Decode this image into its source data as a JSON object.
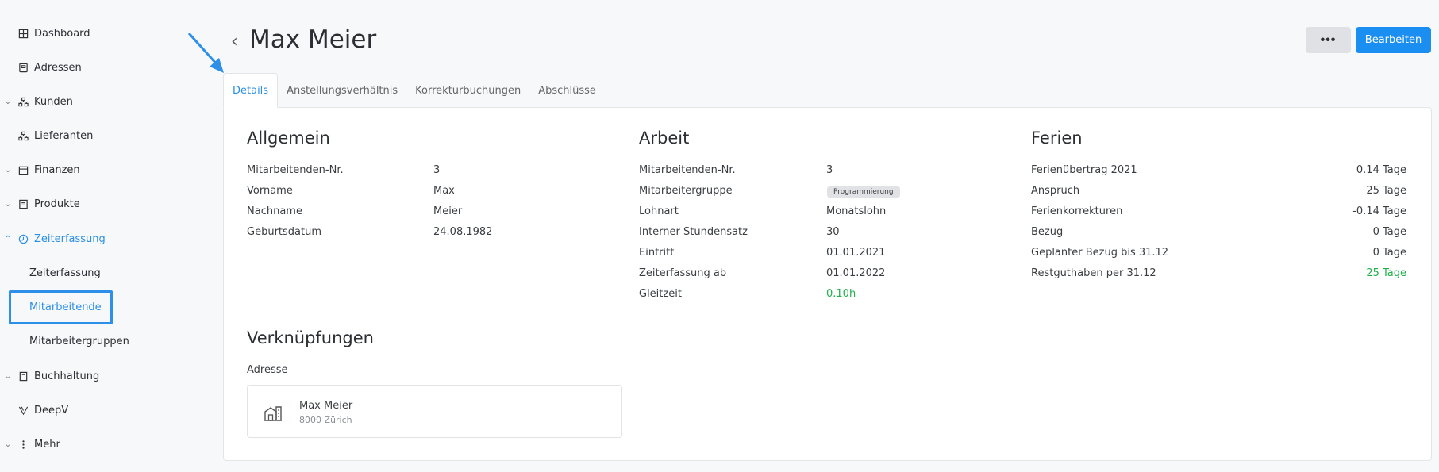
{
  "sidebar": {
    "items": [
      {
        "label": "Dashboard",
        "icon": "grid-icon",
        "has_chevron": false
      },
      {
        "label": "Adressen",
        "icon": "address-book-icon",
        "has_chevron": false
      },
      {
        "label": "Kunden",
        "icon": "org-chart-icon",
        "has_chevron": true
      },
      {
        "label": "Lieferanten",
        "icon": "org-chart-icon",
        "has_chevron": false
      },
      {
        "label": "Finanzen",
        "icon": "calendar-icon",
        "has_chevron": true
      },
      {
        "label": "Produkte",
        "icon": "box-icon",
        "has_chevron": true
      },
      {
        "label": "Zeiterfassung",
        "icon": "clock-icon",
        "has_chevron": true,
        "expanded": true
      },
      {
        "label": "Buchhaltung",
        "icon": "ledger-icon",
        "has_chevron": true
      },
      {
        "label": "DeepV",
        "icon": "deepv-icon",
        "has_chevron": false
      },
      {
        "label": "Mehr",
        "icon": "more-vertical-icon",
        "has_chevron": true
      }
    ],
    "sub_items": [
      "Zeiterfassung",
      "Mitarbeitende",
      "Mitarbeitergruppen"
    ],
    "active_sub": "Mitarbeitende"
  },
  "header": {
    "title": "Max Meier",
    "more_label": "•••",
    "edit_label": "Bearbeiten"
  },
  "tabs": [
    {
      "label": "Details",
      "active": true
    },
    {
      "label": "Anstellungsverhältnis",
      "active": false
    },
    {
      "label": "Korrekturbuchungen",
      "active": false
    },
    {
      "label": "Abschlüsse",
      "active": false
    }
  ],
  "allgemein": {
    "title": "Allgemein",
    "rows": [
      {
        "label": "Mitarbeitenden-Nr.",
        "value": "3"
      },
      {
        "label": "Vorname",
        "value": "Max"
      },
      {
        "label": "Nachname",
        "value": "Meier"
      },
      {
        "label": "Geburtsdatum",
        "value": "24.08.1982"
      }
    ]
  },
  "arbeit": {
    "title": "Arbeit",
    "rows": [
      {
        "label": "Mitarbeitenden-Nr.",
        "value": "3"
      },
      {
        "label": "Mitarbeitergruppe",
        "value": "Programmierung"
      },
      {
        "label": "Lohnart",
        "value": "Monatslohn"
      },
      {
        "label": "Interner Stundensatz",
        "value": "30"
      },
      {
        "label": "Eintritt",
        "value": "01.01.2021"
      },
      {
        "label": "Zeiterfassung ab",
        "value": "01.01.2022"
      },
      {
        "label": "Gleitzeit",
        "value": "0.10h"
      }
    ]
  },
  "ferien": {
    "title": "Ferien",
    "rows": [
      {
        "label": "Ferienübertrag 2021",
        "value": "0.14 Tage"
      },
      {
        "label": "Anspruch",
        "value": "25 Tage"
      },
      {
        "label": "Ferienkorrekturen",
        "value": "-0.14 Tage"
      },
      {
        "label": "Bezug",
        "value": "0 Tage"
      },
      {
        "label": "Geplanter Bezug bis 31.12",
        "value": "0 Tage"
      },
      {
        "label": "Restguthaben per 31.12",
        "value": "25 Tage"
      }
    ]
  },
  "verknuepfungen": {
    "title": "Verknüpfungen",
    "adresse_label": "Adresse",
    "card": {
      "name": "Max Meier",
      "address": "8000 Zürich",
      "icon": "building-icon"
    }
  },
  "colors": {
    "accent": "#1b8ef2",
    "positive": "#20b14c",
    "highlight": "#2e8fe8"
  }
}
